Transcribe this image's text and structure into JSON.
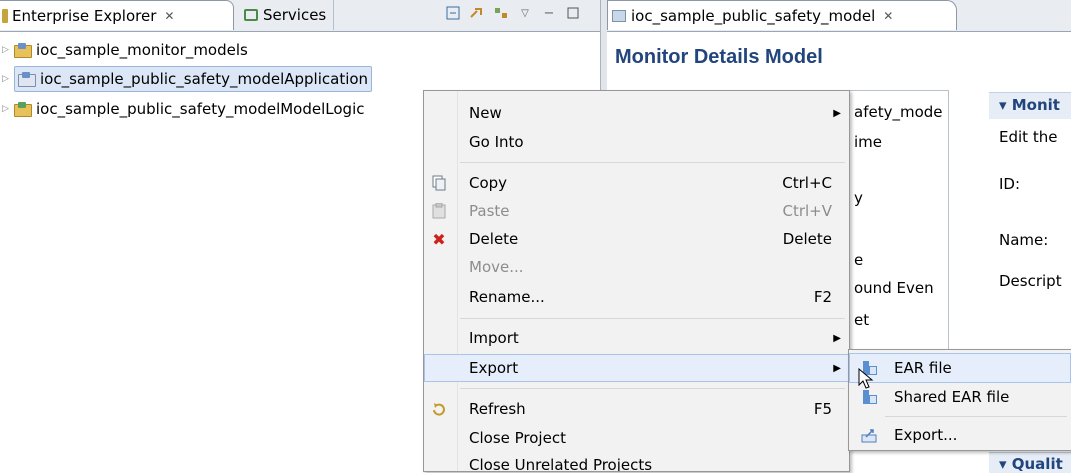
{
  "left_view": {
    "tabs": [
      {
        "label": "Enterprise Explorer",
        "close": "✕"
      },
      {
        "label": "Services"
      }
    ],
    "tree_items": [
      {
        "label": "ioc_sample_monitor_models"
      },
      {
        "label": "ioc_sample_public_safety_modelApplication"
      },
      {
        "label": "ioc_sample_public_safety_modelModelLogic"
      }
    ]
  },
  "editor": {
    "tab_label": "ioc_sample_public_safety_model",
    "tab_close": "✕",
    "title": "Monitor Details Model",
    "model_tree_items": [
      "afety_mode",
      "ime",
      "y",
      "e",
      "ound Even",
      "et"
    ],
    "section_monitor": "▾ Monit",
    "edit_text": "Edit the",
    "field_labels": [
      "ID:",
      "Name:",
      "Descript"
    ],
    "section_quality": "▾ Qualit"
  },
  "context_menu": {
    "items": [
      {
        "label": "New",
        "submenu": true
      },
      {
        "label": "Go Into"
      },
      {
        "label": "Copy",
        "accel": "Ctrl+C",
        "icon": "copy-icon"
      },
      {
        "label": "Paste",
        "accel": "Ctrl+V",
        "icon": "paste-icon",
        "disabled": true
      },
      {
        "label": "Delete",
        "accel": "Delete",
        "icon": "delete-icon"
      },
      {
        "label": "Move...",
        "disabled": true
      },
      {
        "label": "Rename...",
        "accel": "F2"
      },
      {
        "label": "Import",
        "submenu": true
      },
      {
        "label": "Export",
        "submenu": true,
        "highlighted": true
      },
      {
        "label": "Refresh",
        "accel": "F5",
        "icon": "refresh-icon"
      },
      {
        "label": "Close Project"
      },
      {
        "label": "Close Unrelated Projects"
      }
    ]
  },
  "export_submenu": {
    "items": [
      {
        "label": "EAR file",
        "icon": "ear-file-icon",
        "highlighted": true
      },
      {
        "label": "Shared EAR file",
        "icon": "shared-ear-file-icon"
      },
      {
        "label": "Export...",
        "icon": "export-wizard-icon"
      }
    ]
  },
  "colors": {
    "title_blue": "#21457c",
    "selection": "#dbe7f7",
    "menu_hover": "#e5eefa",
    "delete_red": "#d0201b"
  }
}
